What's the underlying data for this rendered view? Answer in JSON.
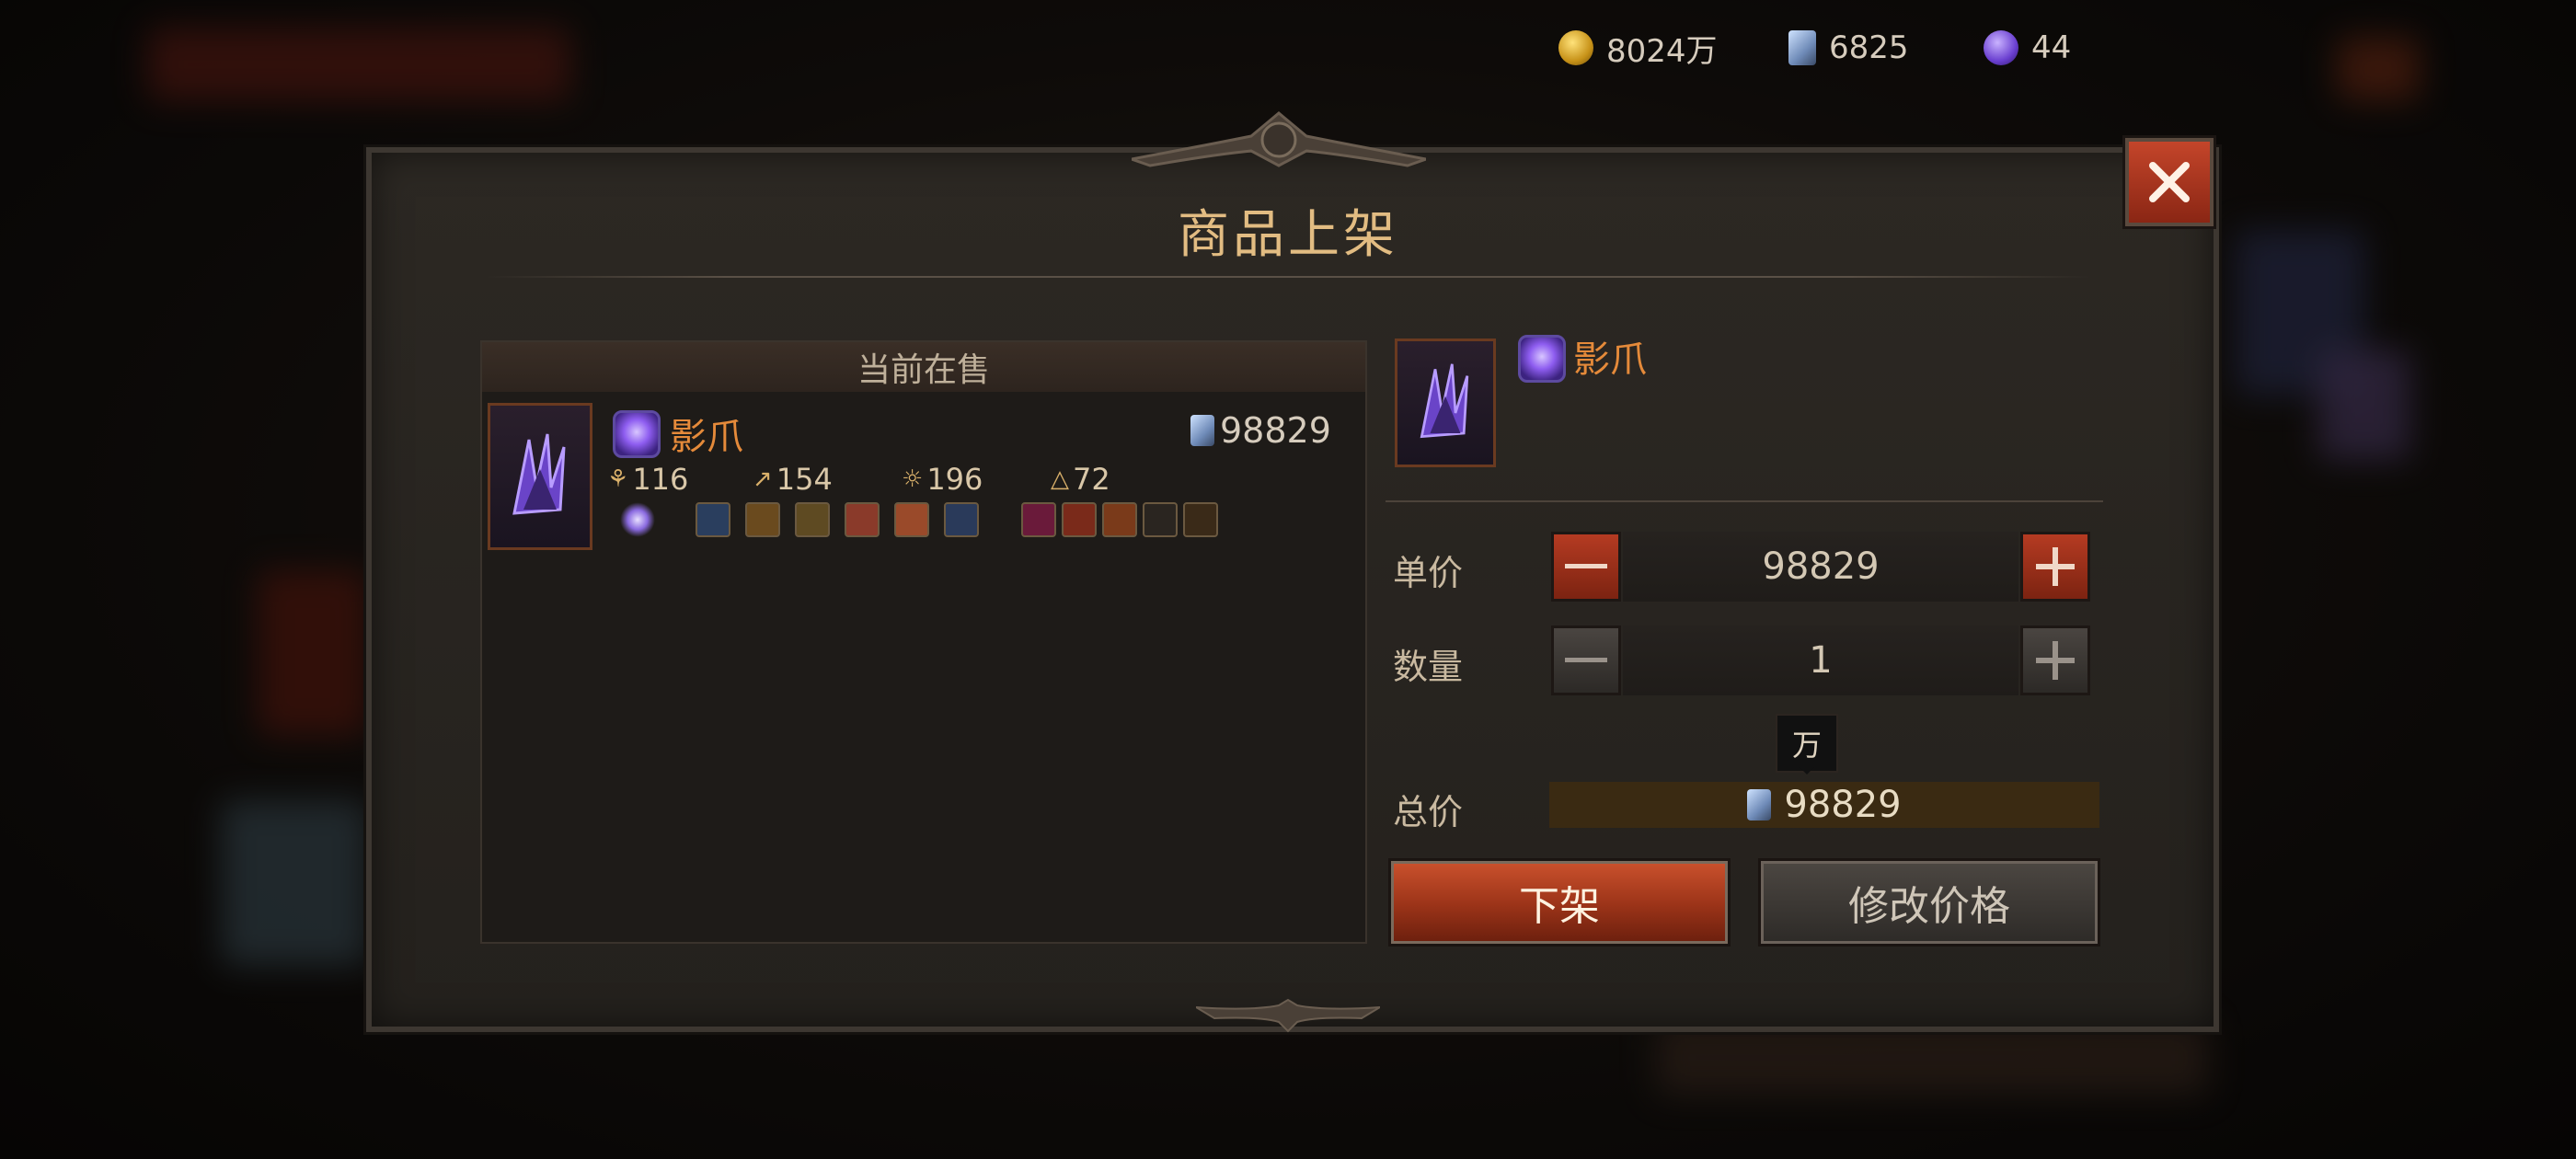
{
  "currency": {
    "gold": "8024万",
    "crystal": "6825",
    "orb": "44"
  },
  "dialog": {
    "title": "商品上架"
  },
  "listing_panel": {
    "header": "当前在售",
    "item": {
      "name": "影爪",
      "price": "98829",
      "stats": [
        "116",
        "154",
        "196",
        "72"
      ],
      "gem_icons": [
        "star-burst-gem-icon",
        "frost-gem-icon",
        "spiral-gem-icon",
        "tree-gem-icon",
        "fire-swirl-gem-icon",
        "flame-gem-icon",
        "ice-claw-gem-icon",
        "rune-ring-icon",
        "demon-face-icon",
        "flame-rune-icon",
        "trident-rune-icon",
        "claw-rune-icon"
      ]
    }
  },
  "sell_panel": {
    "item_name": "影爪",
    "unit_price_label": "单价",
    "unit_price": "98829",
    "quantity_label": "数量",
    "quantity": "1",
    "unit_tag": "万",
    "total_label": "总价",
    "total": "98829",
    "delist_button": "下架",
    "modify_button": "修改价格"
  },
  "colors": {
    "accent_red": "#b53b22",
    "title_gold": "#e2bc82",
    "item_name_orange": "#e58a3a"
  }
}
